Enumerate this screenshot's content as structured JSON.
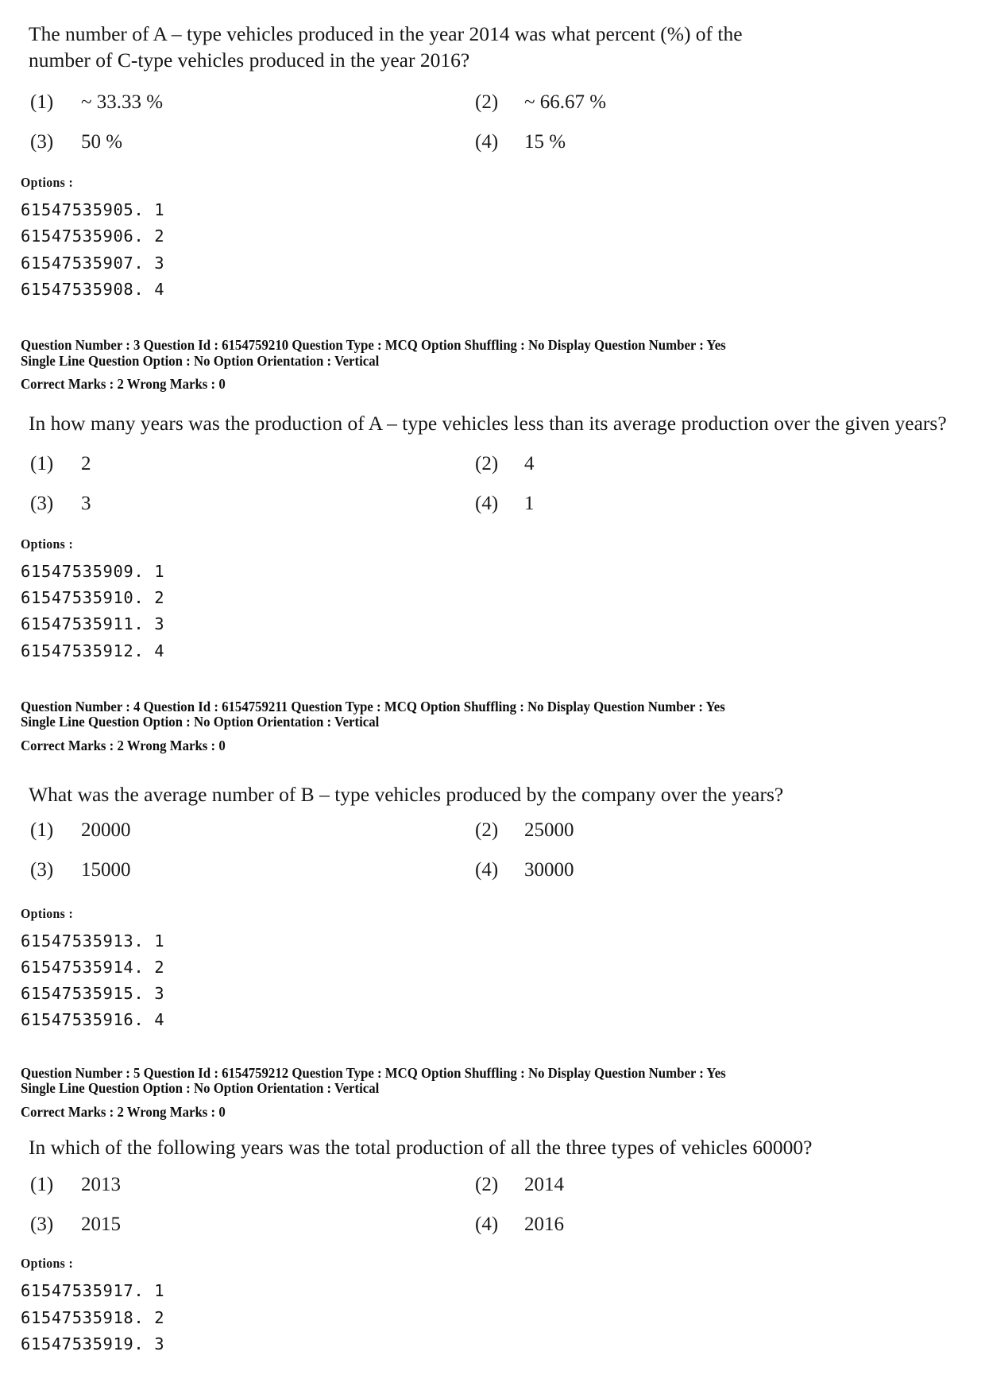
{
  "page": {
    "background_color": "#ffffff",
    "text_color": "#111111"
  },
  "labels": {
    "options_label": "Options :"
  },
  "questions": [
    {
      "id": "question-2-continuation",
      "stem_lines": [
        "The number of A – type vehicles produced in the year 2014 was what percent (%) of the",
        "number of C-type vehicles produced in the year 2016?"
      ],
      "stem_full": "The number of A – type vehicles produced in the year 2014 was what percent (%) of the number of C-type vehicles produced in the year 2016?",
      "choices": [
        {
          "num": "(1)",
          "text": "~ 33.33 %"
        },
        {
          "num": "(2)",
          "text": "~ 66.67 %"
        },
        {
          "num": "(3)",
          "text": "50 %"
        },
        {
          "num": "(4)",
          "text": "15 %"
        }
      ],
      "option_ids": [
        "61547535905. 1",
        "61547535906. 2",
        "61547535907. 3",
        "61547535908. 4"
      ]
    },
    {
      "id": "question-3",
      "meta": {
        "line1": "Question Number : 3  Question Id : 6154759210  Question Type : MCQ  Option Shuffling : No  Display Question Number : Yes",
        "line2": "Single Line Question Option : No  Option Orientation : Vertical",
        "marks": "Correct Marks : 2  Wrong Marks : 0",
        "question_number": "3",
        "question_id": "6154759210",
        "question_type": "MCQ",
        "option_shuffling": "No",
        "display_question_number": "Yes",
        "single_line_question_option": "No",
        "option_orientation": "Vertical",
        "correct_marks": "2",
        "wrong_marks": "0"
      },
      "stem_full": "In how many years was the production of A – type vehicles less than its average production over the given years?",
      "choices": [
        {
          "num": "(1)",
          "text": "2"
        },
        {
          "num": "(2)",
          "text": "4"
        },
        {
          "num": "(3)",
          "text": "3"
        },
        {
          "num": "(4)",
          "text": "1"
        }
      ],
      "option_ids": [
        "61547535909. 1",
        "61547535910. 2",
        "61547535911. 3",
        "61547535912. 4"
      ]
    },
    {
      "id": "question-4",
      "meta": {
        "line1": "Question Number : 4  Question Id : 6154759211  Question Type : MCQ  Option Shuffling : No  Display Question Number : Yes",
        "line2": "Single Line Question Option : No  Option Orientation : Vertical",
        "marks": "Correct Marks : 2  Wrong Marks : 0",
        "question_number": "4",
        "question_id": "6154759211",
        "question_type": "MCQ",
        "option_shuffling": "No",
        "display_question_number": "Yes",
        "single_line_question_option": "No",
        "option_orientation": "Vertical",
        "correct_marks": "2",
        "wrong_marks": "0"
      },
      "stem_full": "What was the average number of B – type vehicles produced by the company over the years?",
      "choices": [
        {
          "num": "(1)",
          "text": "20000"
        },
        {
          "num": "(2)",
          "text": "25000"
        },
        {
          "num": "(3)",
          "text": "15000"
        },
        {
          "num": "(4)",
          "text": "30000"
        }
      ],
      "option_ids": [
        "61547535913. 1",
        "61547535914. 2",
        "61547535915. 3",
        "61547535916. 4"
      ]
    },
    {
      "id": "question-5",
      "meta": {
        "line1": "Question Number : 5  Question Id : 6154759212  Question Type : MCQ  Option Shuffling : No  Display Question Number : Yes",
        "line2": "Single Line Question Option : No  Option Orientation : Vertical",
        "marks": "Correct Marks : 2  Wrong Marks : 0",
        "question_number": "5",
        "question_id": "6154759212",
        "question_type": "MCQ",
        "option_shuffling": "No",
        "display_question_number": "Yes",
        "single_line_question_option": "No",
        "option_orientation": "Vertical",
        "correct_marks": "2",
        "wrong_marks": "0"
      },
      "stem_full": "In which of the following years was the total production of all the three types of vehicles 60000?",
      "choices": [
        {
          "num": "(1)",
          "text": "2013"
        },
        {
          "num": "(2)",
          "text": "2014"
        },
        {
          "num": "(3)",
          "text": "2015"
        },
        {
          "num": "(4)",
          "text": "2016"
        }
      ],
      "option_ids": [
        "61547535917. 1",
        "61547535918. 2",
        "61547535919. 3"
      ]
    }
  ]
}
